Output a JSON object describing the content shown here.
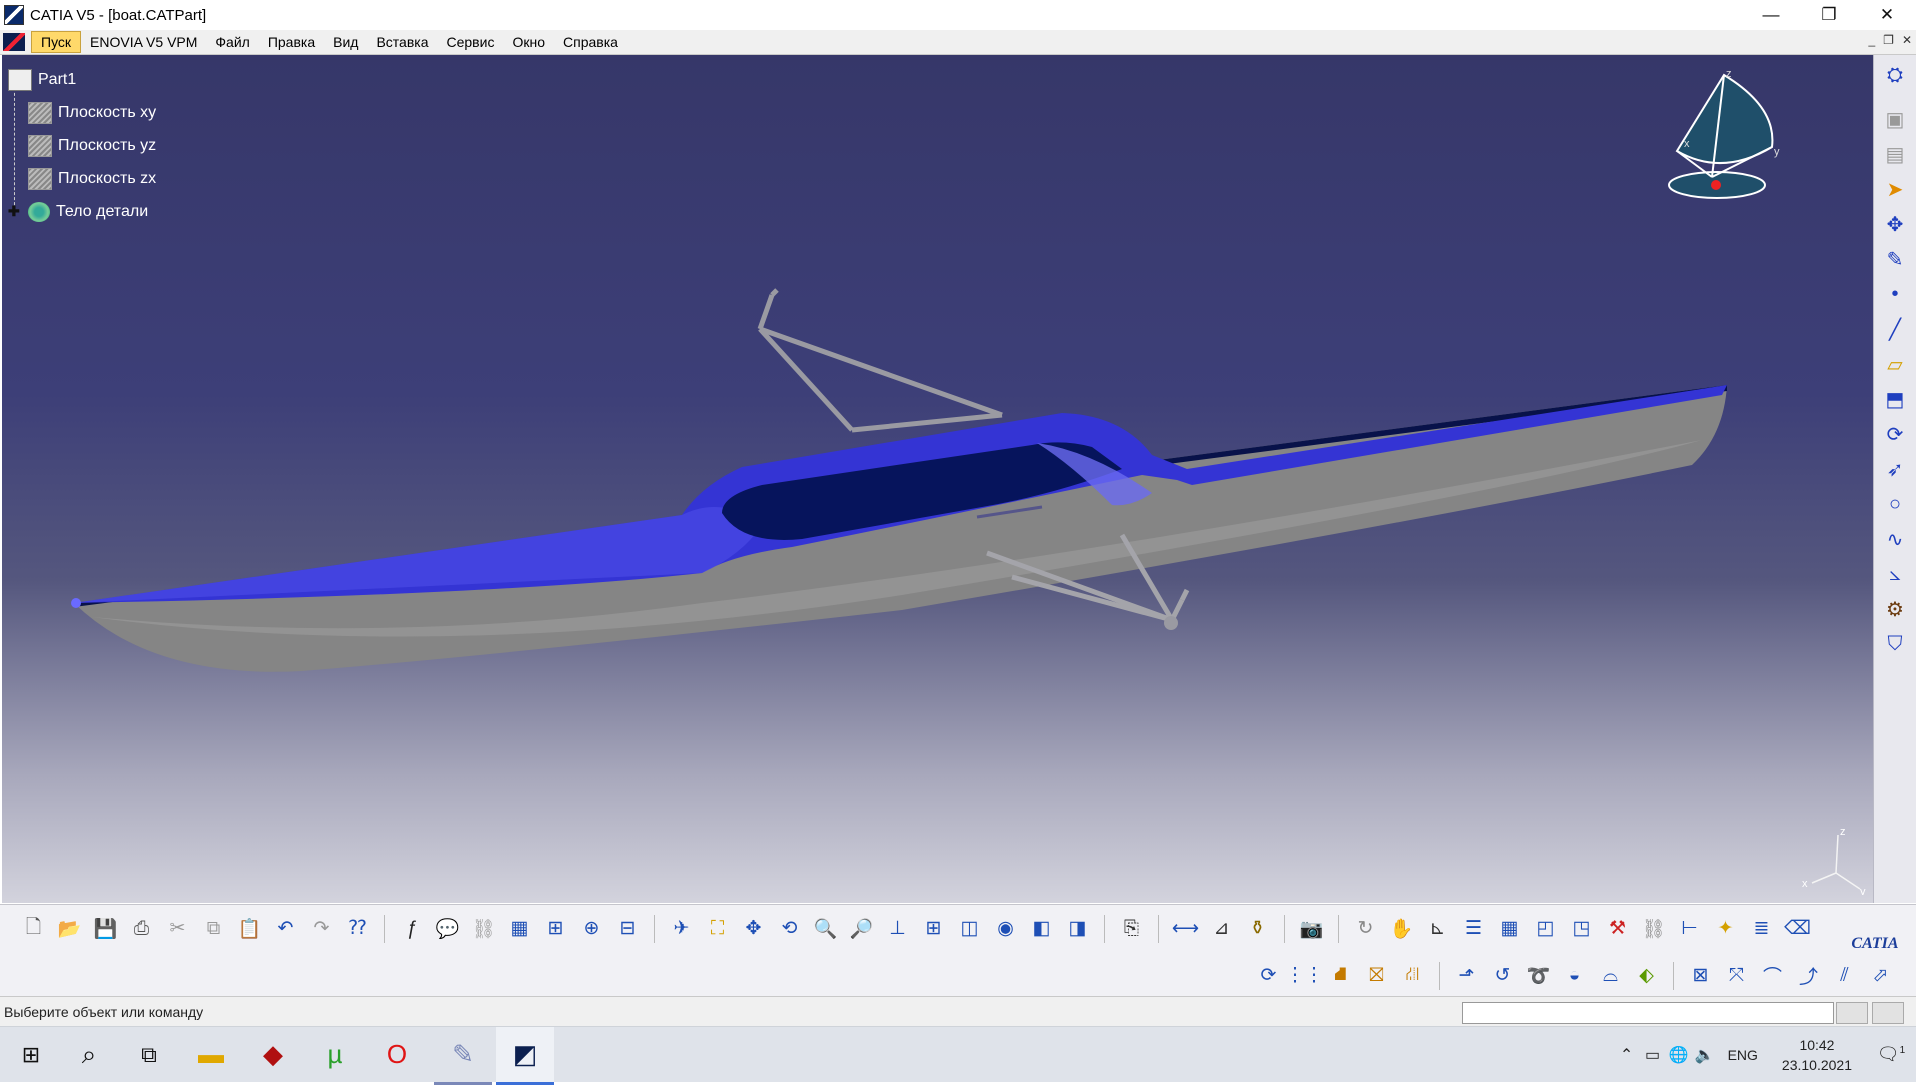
{
  "window": {
    "title": "CATIA V5 - [boat.CATPart]",
    "minimize": "—",
    "restore": "❐",
    "close": "✕"
  },
  "menu": {
    "items": [
      "Пуск",
      "ENOVIA V5 VPM",
      "Файл",
      "Правка",
      "Вид",
      "Вставка",
      "Сервис",
      "Окно",
      "Справка"
    ]
  },
  "tree": {
    "root": "Part1",
    "children": [
      "Плоскость xy",
      "Плоскость yz",
      "Плоскость zx",
      "Тело детали"
    ]
  },
  "compass": {
    "x": "x",
    "y": "y",
    "z": "z"
  },
  "status": {
    "message": "Выберите объект или команду"
  },
  "logo": "CATIA",
  "taskbar": {
    "language": "ENG",
    "time": "10:42",
    "date": "23.10.2021",
    "notification_count": "1"
  },
  "colors": {
    "hull_top": "#3535d8",
    "hull_side": "#8a8a8a",
    "viewport_top": "#363769"
  }
}
